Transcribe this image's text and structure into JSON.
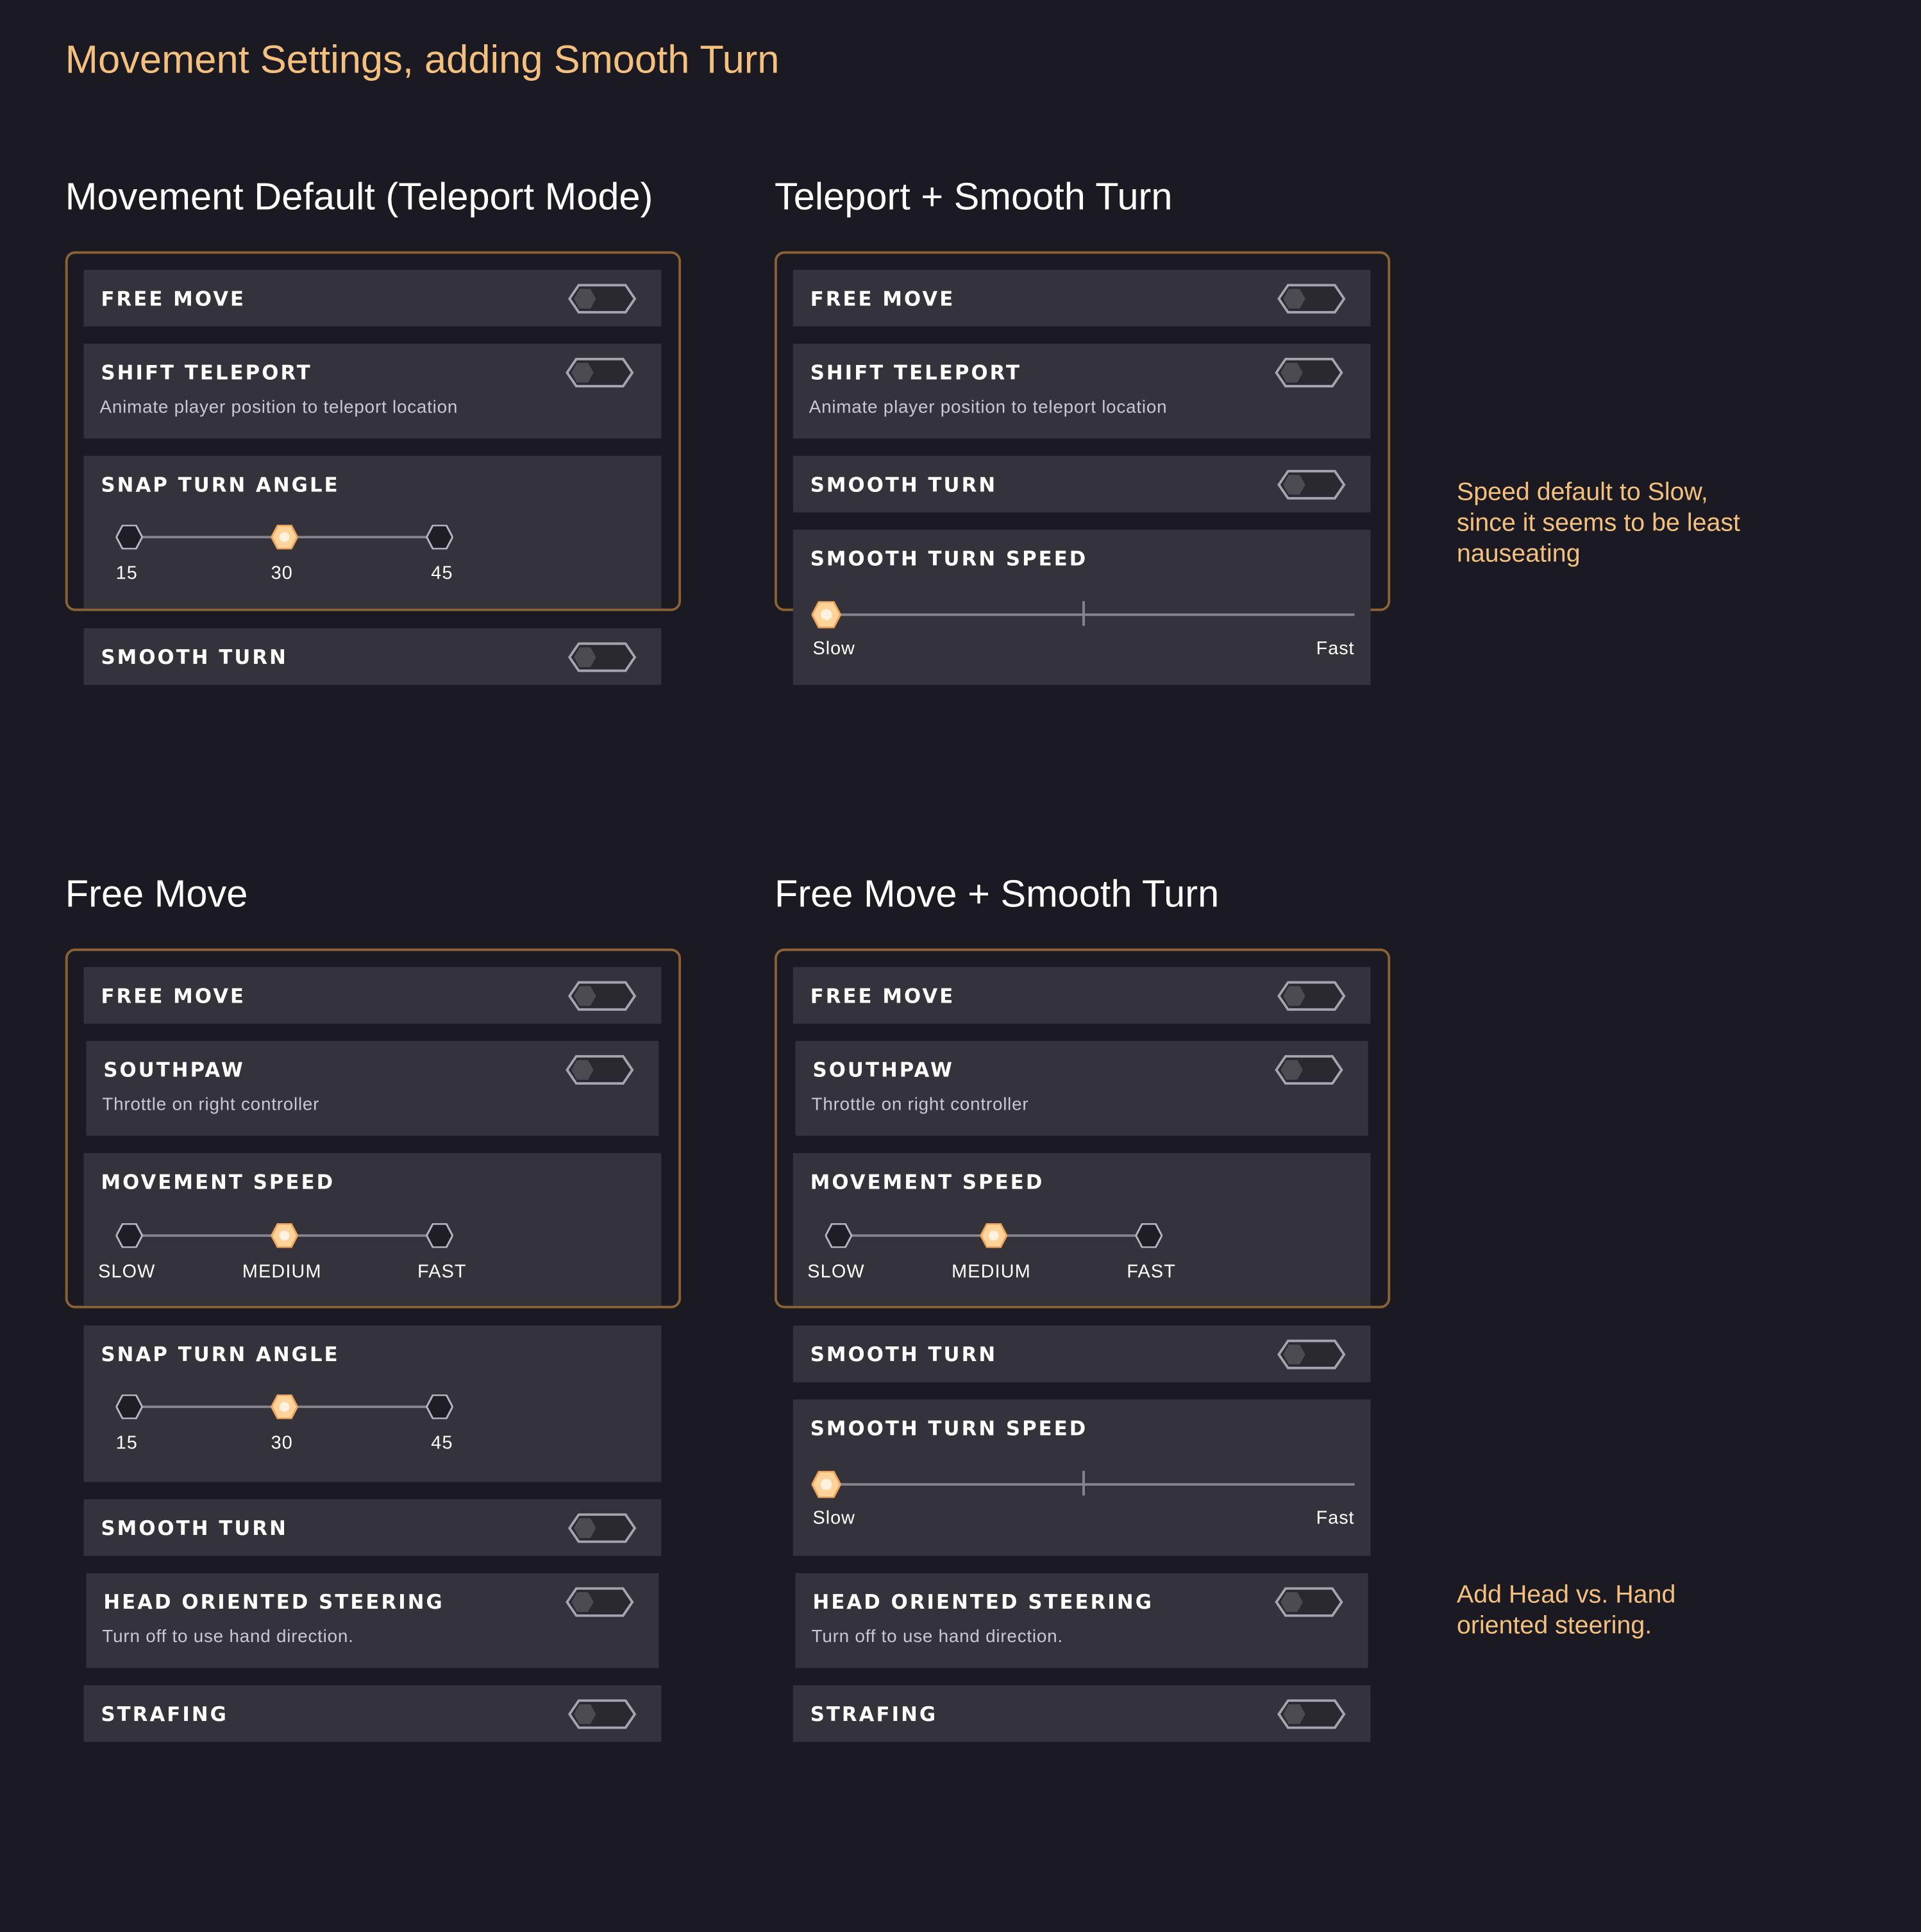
{
  "page_title": "Movement Settings, adding Smooth Turn",
  "sections": {
    "default": {
      "title": "Movement Default (Teleport Mode)"
    },
    "teleport_smooth": {
      "title": "Teleport + Smooth Turn"
    },
    "free_move": {
      "title": "Free Move"
    },
    "free_move_smooth": {
      "title": "Free Move + Smooth Turn"
    }
  },
  "labels": {
    "free_move": "FREE MOVE",
    "shift_teleport": "SHIFT TELEPORT",
    "shift_teleport_desc": "Animate player position to teleport location",
    "snap_turn_angle": "SNAP TURN ANGLE",
    "smooth_turn": "SMOOTH TURN",
    "smooth_turn_speed": "SMOOTH TURN SPEED",
    "southpaw": "SOUTHPAW",
    "southpaw_desc": "Throttle on right controller",
    "movement_speed": "MOVEMENT SPEED",
    "head_oriented_steering": "HEAD ORIENTED STEERING",
    "head_oriented_steering_desc": "Turn off to use hand direction.",
    "strafing": "STRAFING"
  },
  "snap_angle_options": [
    "15",
    "30",
    "45"
  ],
  "snap_angle_selected": "30",
  "movement_speed_options": [
    "SLOW",
    "MEDIUM",
    "FAST"
  ],
  "movement_speed_selected": "MEDIUM",
  "smooth_speed": {
    "min_label": "Slow",
    "max_label": "Fast",
    "value": 0
  },
  "toggles": {
    "default": {
      "free_move": false,
      "shift_teleport": false,
      "smooth_turn": false
    },
    "teleport_smooth": {
      "free_move": false,
      "shift_teleport": false,
      "smooth_turn": true
    },
    "free_move": {
      "free_move": true,
      "southpaw": false,
      "smooth_turn": false,
      "head_oriented_steering": true,
      "strafing": true
    },
    "free_move_smooth": {
      "free_move": true,
      "southpaw": false,
      "smooth_turn": true,
      "head_oriented_steering": true,
      "strafing": true
    }
  },
  "notes": {
    "speed": [
      "Speed default to Slow,",
      "since it seems to be least",
      "nauseating"
    ],
    "steering": [
      "Add Head vs. Hand",
      "oriented steering."
    ]
  },
  "colors": {
    "background": "#1b1a22",
    "card": "#34333c",
    "accent": "#f3c07e",
    "highlight_border": "#8a6236",
    "toggle_on_knob": "#f08a3a",
    "toggle_off": "#4c4b52"
  }
}
